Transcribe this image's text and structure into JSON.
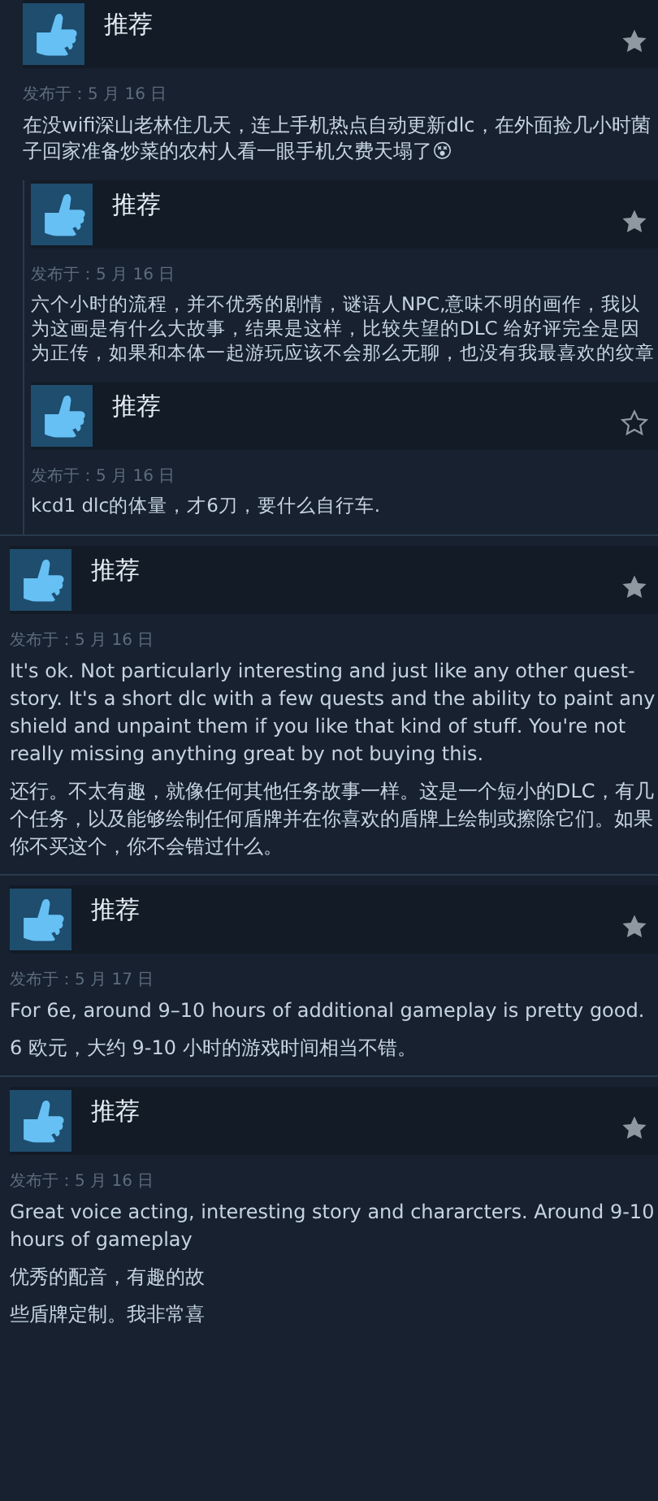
{
  "reviews": [
    {
      "verdict": "推荐",
      "starred": true,
      "date": "发布于：5 月 16 日",
      "paragraphs": [
        "在没wifi深山老林住几天，连上手机热点自动更新dlc，在外面捡几小时菌子回家准备炒菜的农村人看一眼手机欠费天塌了😵"
      ]
    },
    {
      "verdict": "推荐",
      "starred": true,
      "date": "发布于：5 月 16 日",
      "paragraphs": [
        "六个小时的流程，并不优秀的剧情，谜语人NPC,意味不明的画作，我以为这画是有什么大故事，结果是这样，比较失望的DLC 给好评完全是因为正传，如果和本体一起游玩应该不会那么无聊，也没有我最喜欢的纹章"
      ]
    },
    {
      "verdict": "推荐",
      "starred": false,
      "date": "发布于：5 月 16 日",
      "paragraphs": [
        "kcd1 dlc的体量，才6刀，要什么自行车."
      ]
    },
    {
      "verdict": "推荐",
      "starred": true,
      "date": "发布于：5 月 16 日",
      "paragraphs": [
        "It's ok. Not particularly interesting and just like any other quest-story. It's a short dlc with a few quests and the ability to paint any shield and unpaint them if you like that kind of stuff. You're not really missing anything great by not buying this.",
        "还行。不太有趣，就像任何其他任务故事一样。这是一个短小的DLC，有几个任务，以及能够绘制任何盾牌并在你喜欢的盾牌上绘制或擦除它们。如果你不买这个，你不会错过什么。"
      ]
    },
    {
      "verdict": "推荐",
      "starred": true,
      "date": "发布于：5 月 17 日",
      "paragraphs": [
        "For 6e, around 9–10 hours of additional gameplay is pretty good.",
        "6 欧元，大约 9-10 小时的游戏时间相当不错。"
      ]
    },
    {
      "verdict": "推荐",
      "starred": true,
      "date": "发布于：5 月 16 日",
      "paragraphs": [
        "Great voice acting, interesting story and chararcters. Around 9-10 hours of gameplay",
        "优秀的配音，有趣的故",
        "些盾牌定制。我非常喜"
      ]
    }
  ]
}
